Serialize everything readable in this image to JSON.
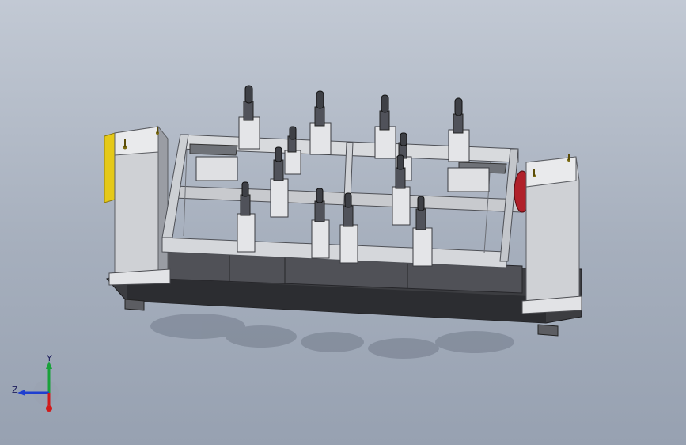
{
  "viewport": {
    "background_top": "#c2c9d4",
    "background_bottom": "#97a1b1"
  },
  "model": {
    "description_icon": "welding-fixture-positioner-model",
    "frame_color": "#d4d6da",
    "frame_shade": "#8d9098",
    "base_color": "#3f3f42",
    "accent_color": "#e5c918",
    "stop_color": "#b0202a"
  },
  "triad": {
    "x_label": "",
    "y_label": "Y",
    "z_label": "Z",
    "y_color": "#19a13a",
    "z_color": "#1f3fd0",
    "x_color": "#d11a1a"
  }
}
